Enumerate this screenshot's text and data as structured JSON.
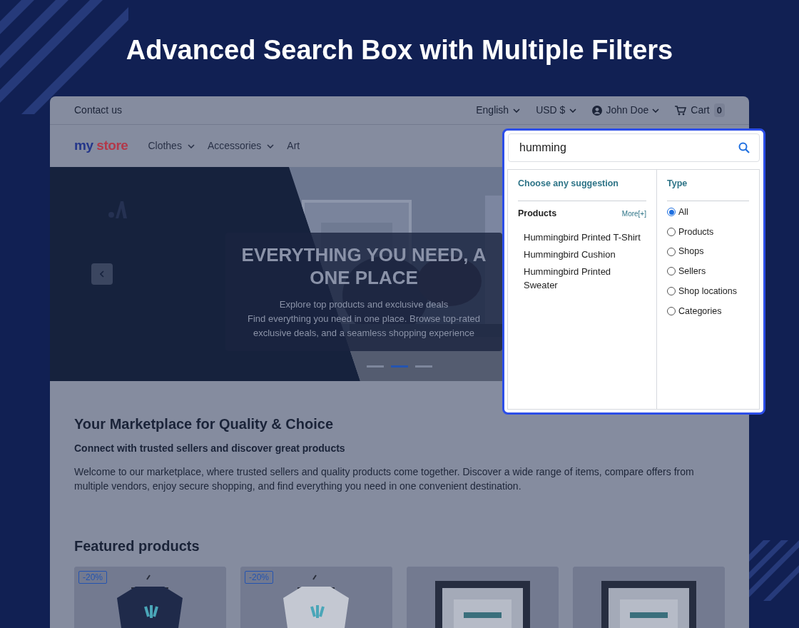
{
  "banner_title": "Advanced Search Box with Multiple Filters",
  "store": {
    "top_bar": {
      "contact": "Contact us",
      "language": "English",
      "currency": "USD $",
      "user": "John Doe",
      "cart_label": "Cart",
      "cart_count": "0"
    },
    "logo": [
      "my",
      "store"
    ],
    "nav": [
      {
        "label": "Clothes",
        "dropdown": true
      },
      {
        "label": "Accessories",
        "dropdown": true
      },
      {
        "label": "Art",
        "dropdown": false
      }
    ],
    "hero": {
      "heading_lines": [
        "EVERYTHING YOU NEED, A",
        "ONE PLACE"
      ],
      "text_lines": [
        "Explore top products and exclusive deals",
        "Find everything you need in one place. Browse top-rated",
        "exclusive deals, and a seamless shopping experience"
      ],
      "slides": [
        {
          "selected": false
        },
        {
          "selected": true
        },
        {
          "selected": false
        }
      ]
    },
    "intro": {
      "title": "Your Marketplace for Quality & Choice",
      "subtitle": "Connect with trusted sellers and discover great products",
      "text": "Welcome to our marketplace, where trusted sellers and quality products come together. Discover a wide range of items, compare offers from multiple vendors, enjoy secure shopping, and find everything you need in one convenient destination."
    },
    "featured": {
      "title": "Featured products",
      "products": [
        {
          "badge": "-20%",
          "kind": "picture"
        },
        {
          "badge": "-20%",
          "kind": "picture"
        },
        {
          "kind": "picture"
        },
        {
          "kind": "picture"
        }
      ]
    }
  },
  "search": {
    "value": "humming",
    "suggestions_title": "Choose any suggestion",
    "group_title": "Products",
    "more": "More[+]",
    "suggestions": [
      "Hummingbird Printed T-Shirt",
      "Hummingbird Cushion",
      "Hummingbird Printed Sweater"
    ],
    "type_title": "Type",
    "types": [
      {
        "label": "All",
        "selected": true
      },
      {
        "label": "Products",
        "selected": false
      },
      {
        "label": "Shops",
        "selected": false
      },
      {
        "label": "Sellers",
        "selected": false
      },
      {
        "label": "Shop locations",
        "selected": false
      },
      {
        "label": "Categories",
        "selected": false
      }
    ]
  }
}
